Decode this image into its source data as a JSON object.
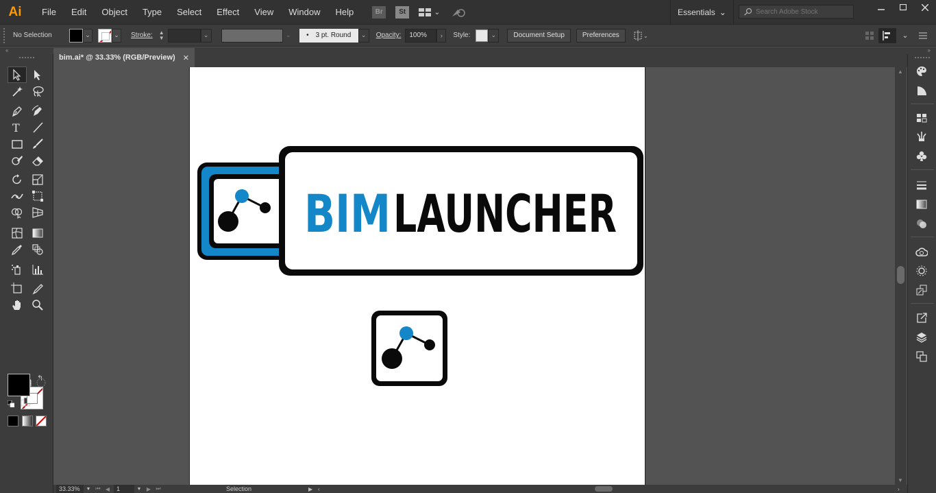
{
  "app": {
    "logo": "Ai",
    "menu": [
      "File",
      "Edit",
      "Object",
      "Type",
      "Select",
      "Effect",
      "View",
      "Window",
      "Help"
    ],
    "bridge_label": "Br",
    "stock_label": "St",
    "workspace": "Essentials",
    "search_placeholder": "Search Adobe Stock",
    "window_controls": [
      "minimize",
      "maximize",
      "close"
    ]
  },
  "control_bar": {
    "selection": "No Selection",
    "stroke_label": "Stroke:",
    "brush": "3 pt. Round",
    "opacity_label": "Opacity:",
    "opacity": "100%",
    "style_label": "Style:",
    "document_setup": "Document Setup",
    "preferences": "Preferences"
  },
  "document": {
    "tab_title": "bim.ai* @ 33.33% (RGB/Preview)",
    "close": "✕"
  },
  "artwork": {
    "logo_text_bim": "BIM",
    "logo_text_launcher": "LAUNCHER",
    "colors": {
      "blue": "#1487c8",
      "black": "#0a0a0a"
    }
  },
  "status_bar": {
    "zoom": "33.33%",
    "page": "1",
    "status": "Selection"
  },
  "colors": {
    "app_bg": "#535353",
    "panel_bg": "#3c3c3c",
    "menubar_bg": "#323232",
    "accent": "#ff9a00"
  }
}
